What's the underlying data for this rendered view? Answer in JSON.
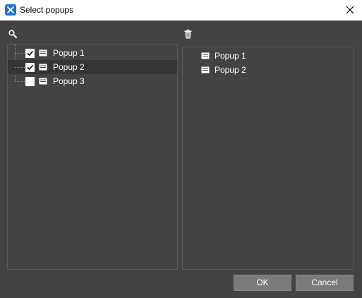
{
  "window": {
    "title": "Select popups",
    "app_icon": "app-tools-icon",
    "close_icon": "close-icon"
  },
  "toolbar": {
    "search_icon": "search-icon",
    "delete_icon": "trash-icon"
  },
  "available_list": {
    "items": [
      {
        "label": "Popup 1",
        "checked": true,
        "selected": false,
        "icon": "popup-icon"
      },
      {
        "label": "Popup 2",
        "checked": true,
        "selected": true,
        "icon": "popup-icon"
      },
      {
        "label": "Popup 3",
        "checked": false,
        "selected": false,
        "icon": "popup-icon"
      }
    ]
  },
  "selected_list": {
    "items": [
      {
        "label": "Popup 1",
        "icon": "popup-icon"
      },
      {
        "label": "Popup 2",
        "icon": "popup-icon"
      }
    ]
  },
  "buttons": {
    "ok_label": "OK",
    "cancel_label": "Cancel"
  },
  "colors": {
    "background": "#434343",
    "button": "#7a7a7a",
    "selected_row": "#353535",
    "app_icon_bg": "#1e73c8"
  }
}
